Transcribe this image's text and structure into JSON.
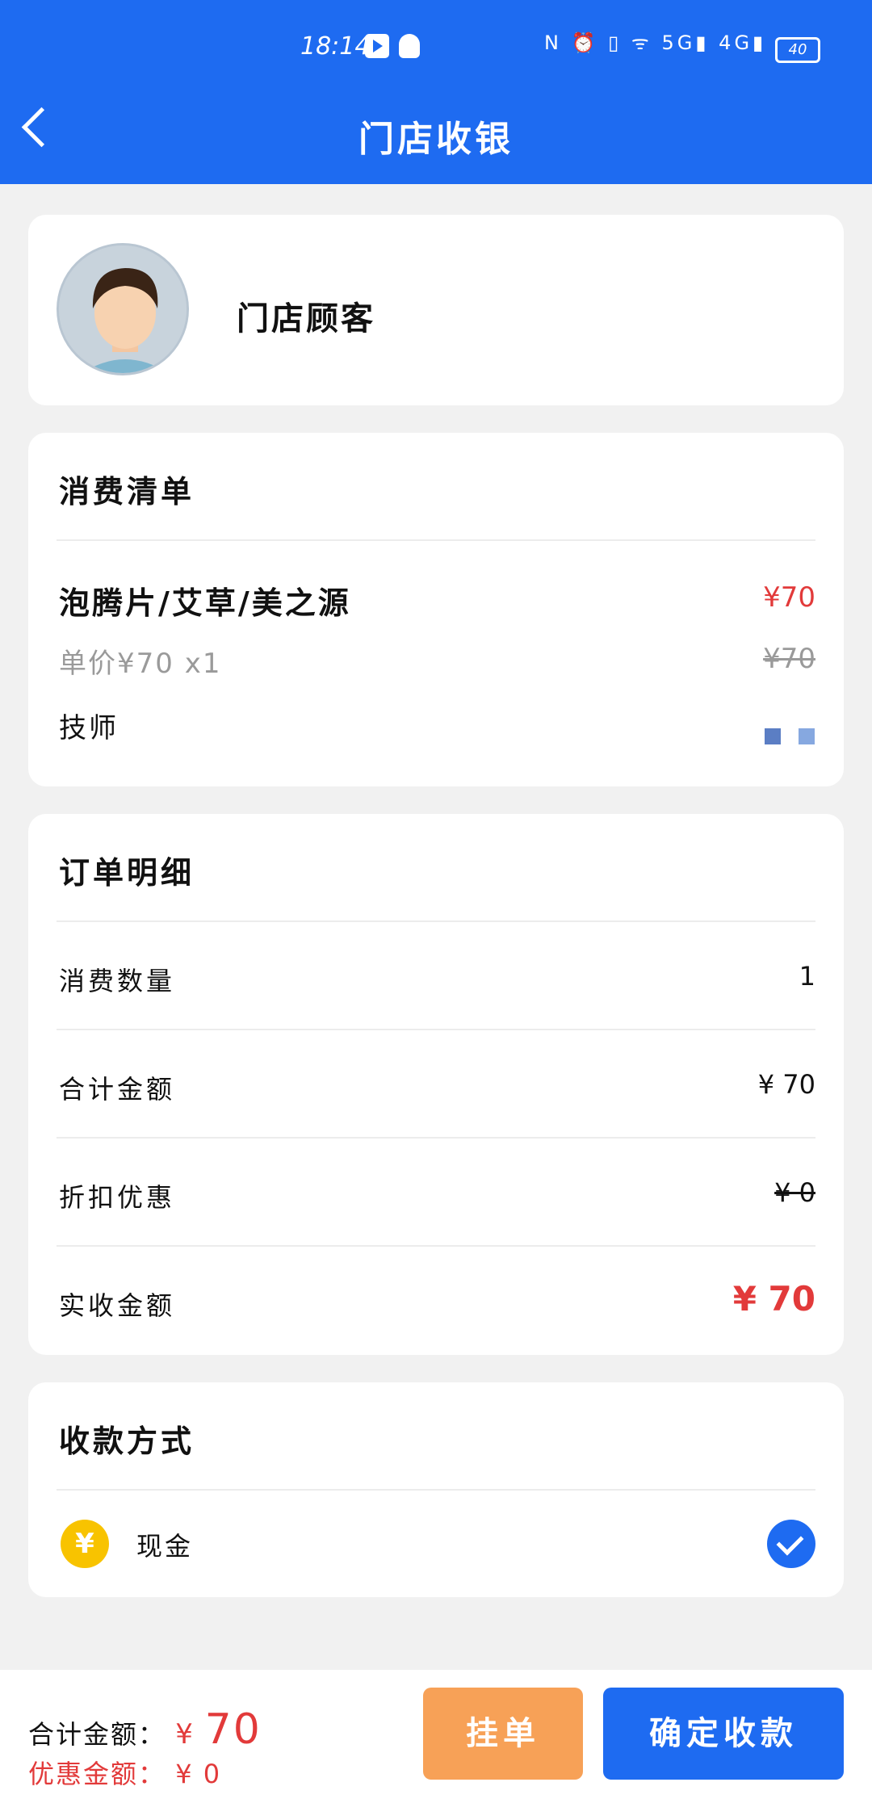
{
  "status_bar": {
    "time": "18:14",
    "right_icons": "N ⏰ ▯ ᯤ 5G▮ 4G▮",
    "battery": "40"
  },
  "header": {
    "title": "门店收银"
  },
  "customer": {
    "name": "门店顾客"
  },
  "consumption": {
    "title": "消费清单",
    "item": {
      "name": "泡腾片/艾草/美之源",
      "price": "¥70",
      "unit_price": "单价¥70 x1",
      "original_price": "¥70",
      "technician_label": "技师"
    }
  },
  "order": {
    "title": "订单明细",
    "rows": [
      {
        "label": "消费数量",
        "value": "1"
      },
      {
        "label": "合计金额",
        "value": "¥ 70"
      },
      {
        "label": "折扣优惠",
        "value": "¥ 0"
      },
      {
        "label": "实收金额",
        "value": "¥ 70"
      }
    ]
  },
  "payment": {
    "title": "收款方式",
    "method_icon": "¥",
    "method": "现金"
  },
  "footer": {
    "total_label": "合计金额：",
    "total_currency": "¥",
    "total_value": "70",
    "discount_label": "优惠金额：",
    "discount_value": "¥ 0",
    "hold_button": "挂单",
    "confirm_button": "确定收款"
  },
  "colors": {
    "primary": "#1e6bf1",
    "accent_red": "#e23a3a",
    "hold_orange": "#f7a157",
    "cash_yellow": "#f8c300"
  }
}
